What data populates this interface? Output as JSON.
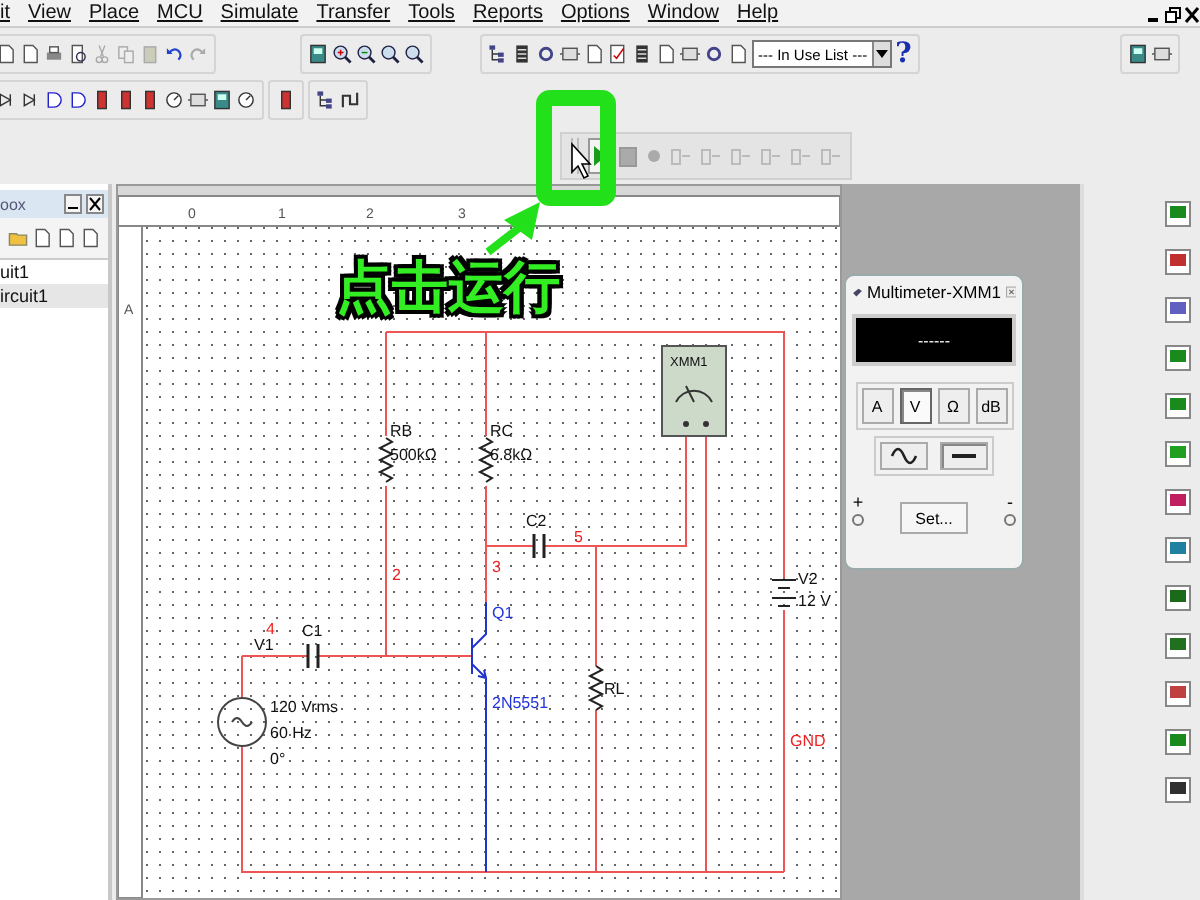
{
  "menu_bar": {
    "items": [
      "it",
      "View",
      "Place",
      "MCU",
      "Simulate",
      "Transfer",
      "Tools",
      "Reports",
      "Options",
      "Window",
      "Help"
    ]
  },
  "toolbar": {
    "component_list": {
      "value": "--- In Use List ---"
    },
    "help": "?"
  },
  "design_toolbox": {
    "title": "oox",
    "tree": [
      {
        "label": "uit1",
        "selected": false,
        "children": [
          {
            "label": "ircuit1",
            "selected": true
          }
        ]
      }
    ]
  },
  "ruler": {
    "columns": [
      "0",
      "1",
      "2",
      "3"
    ],
    "rows": [
      "A"
    ]
  },
  "schematic": {
    "labels": [
      {
        "text": "XMM1",
        "kind": "ref"
      },
      {
        "text": "RB",
        "kind": "ref"
      },
      {
        "text": "500kΩ",
        "kind": "value"
      },
      {
        "text": "RC",
        "kind": "ref"
      },
      {
        "text": "6.8kΩ",
        "kind": "value"
      },
      {
        "text": "C2",
        "kind": "ref"
      },
      {
        "text": "5",
        "kind": "net"
      },
      {
        "text": "3",
        "kind": "net"
      },
      {
        "text": "2",
        "kind": "net"
      },
      {
        "text": "V2",
        "kind": "ref"
      },
      {
        "text": "12 V",
        "kind": "value"
      },
      {
        "text": "Q1",
        "kind": "part"
      },
      {
        "text": "C1",
        "kind": "ref"
      },
      {
        "text": "4",
        "kind": "net"
      },
      {
        "text": "V1",
        "kind": "ref"
      },
      {
        "text": "2N5551",
        "kind": "part"
      },
      {
        "text": "RL",
        "kind": "ref"
      },
      {
        "text": "120 Vrms",
        "kind": "value"
      },
      {
        "text": "60 Hz",
        "kind": "value"
      },
      {
        "text": "0°",
        "kind": "value"
      },
      {
        "text": "GND",
        "kind": "net"
      }
    ]
  },
  "multimeter": {
    "title": "Multimeter-XMM1",
    "display": "------",
    "modes": [
      {
        "label": "A",
        "selected": false
      },
      {
        "label": "V",
        "selected": true
      },
      {
        "label": "Ω",
        "selected": false
      },
      {
        "label": "dB",
        "selected": false
      }
    ],
    "signal": [
      {
        "kind": "ac",
        "selected": false
      },
      {
        "kind": "dc",
        "selected": true
      }
    ],
    "set_button": "Set...",
    "terminals": [
      "+",
      "-"
    ]
  },
  "annotation": {
    "text": "点击运行"
  }
}
